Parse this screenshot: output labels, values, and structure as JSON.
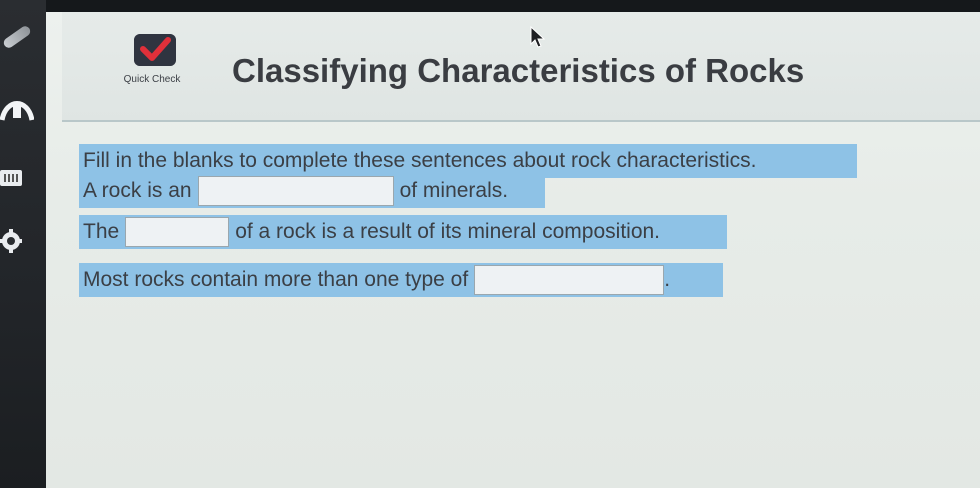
{
  "header": {
    "quick_check_label": "Quick Check",
    "title": "Classifying Characteristics of Rocks"
  },
  "instructions": "Fill in the blanks to complete these sentences about rock characteristics.",
  "sentences": [
    {
      "before": "A rock is an",
      "after": "of minerals.",
      "blank_value": ""
    },
    {
      "before": "The",
      "after": "of a rock is a result of its mineral composition.",
      "blank_value": ""
    },
    {
      "before": "Most rocks contain more than one type of",
      "after": ".",
      "blank_value": ""
    }
  ],
  "icons": {
    "check": "checkmark-icon",
    "pen": "pen-icon",
    "arc": "arc-tool-icon",
    "ruler": "ruler-icon",
    "gear": "gear-icon",
    "cursor": "arrow-cursor-icon"
  },
  "colors": {
    "highlight": "#8ec2e6",
    "check_red": "#e0303a",
    "page_bg": "#e7ece8",
    "toolbar_bg": "#222529"
  }
}
